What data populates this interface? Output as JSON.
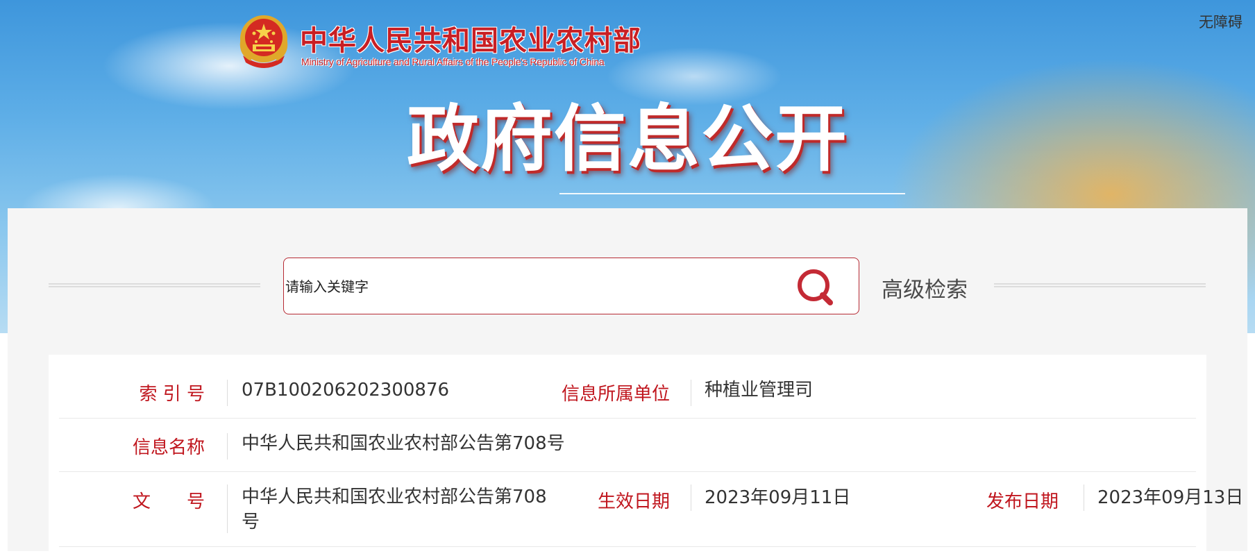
{
  "header": {
    "site_name_cn": "中华人民共和国农业农村部",
    "site_name_en": "Ministry of Agriculture and Rural Affairs of the People's Republic of China",
    "accessibility_label": "无障碍",
    "banner_title": "政府信息公开",
    "emblem_icon": "national-emblem-icon"
  },
  "search": {
    "placeholder": "请输入关键字",
    "search_icon": "search-icon",
    "advanced_label": "高级检索"
  },
  "info": {
    "rows": [
      {
        "cells": [
          {
            "label": "索 引 号",
            "value": "07B100206202300876"
          },
          {
            "label": "信息所属单位",
            "value": "种植业管理司"
          }
        ]
      },
      {
        "cells": [
          {
            "label": "信息名称",
            "value": "中华人民共和国农业农村部公告第708号"
          }
        ]
      },
      {
        "cells": [
          {
            "label": "文　　号",
            "value": "中华人民共和国农业农村部公告第708号"
          },
          {
            "label": "生效日期",
            "value": "2023年09月11日"
          },
          {
            "label": "发布日期",
            "value": "2023年09月13日"
          }
        ]
      }
    ]
  },
  "colors": {
    "brand_red": "#c0161e",
    "search_border": "#b62a33",
    "panel_bg": "#f5f5f5"
  }
}
